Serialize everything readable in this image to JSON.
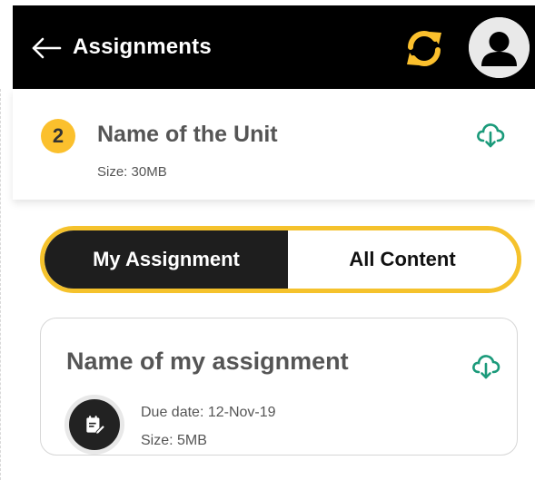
{
  "header": {
    "title": "Assignments",
    "back_icon": "arrow-left-icon",
    "sync_icon": "sync-icon",
    "avatar_icon": "user-avatar-icon",
    "accent_color": "#fbc02d"
  },
  "unit": {
    "number": "2",
    "name": "Name of the Unit",
    "size": "Size: 30MB",
    "download_icon": "cloud-download-icon"
  },
  "toggle": {
    "tabs": [
      {
        "label": "My Assignment",
        "active": true
      },
      {
        "label": "All Content",
        "active": false
      }
    ]
  },
  "assignment": {
    "name": "Name of my assignment",
    "due_date": "Due date: 12-Nov-19",
    "size": "Size: 5MB",
    "icon": "assignment-edit-icon",
    "download_icon": "cloud-download-icon",
    "download_color": "#1a9a7a"
  }
}
